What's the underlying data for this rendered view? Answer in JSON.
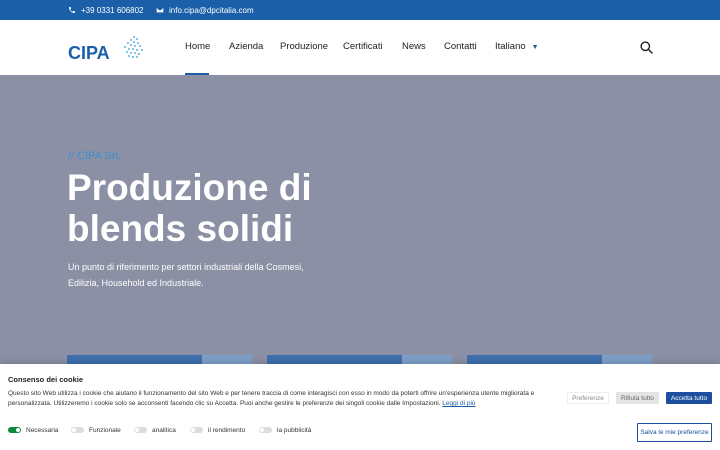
{
  "topbar": {
    "phone": "+39 0331 606802",
    "email": "info.cipa@dpcitalia.com",
    "phone_icon": "phone-icon",
    "email_icon": "envelope-icon"
  },
  "header": {
    "logo_text": "CIPA",
    "nav": [
      {
        "label": "Home",
        "active": true
      },
      {
        "label": "Azienda"
      },
      {
        "label": "Produzione"
      },
      {
        "label": "Certificati"
      },
      {
        "label": "News"
      },
      {
        "label": "Contatti"
      },
      {
        "label": "Italiano",
        "has_dropdown": true
      }
    ],
    "search_icon": "search-icon",
    "accent_color": "#1b5fa8"
  },
  "hero": {
    "eyebrow": "// CIPA Srl.",
    "title_line1": "Produzione di",
    "title_line2": "blends solidi",
    "subtitle_line1": "Un punto di riferimento per settori industriali della Cosmesi,",
    "subtitle_line2": "Edilizia, Household ed Industriale.",
    "background_color": "#8b90a5"
  },
  "cookie": {
    "title": "Consenso dei cookie",
    "text_line1": "Questo sito Web utilizza i cookie che aiutano il funzionamento del sito Web e per tenere traccia di come interagisci con esso in modo da poterti offrire un'esperienza utente migliorata e",
    "text_line2": "personalizzata. Utilizzeremo i cookie solo se acconsenti facendo clic su Accetta. Puoi anche gestire le preferenze dei singoli cookie dalle Impostazioni.",
    "read_more": "Leggi di più",
    "buttons": {
      "preferences": "Preferenze",
      "reject": "Rifiuta tutto",
      "accept": "Accetta tutto",
      "save": "Salva le mie preferenze"
    },
    "toggles": [
      {
        "label": "Necessaria",
        "on": true
      },
      {
        "label": "Funzionale",
        "on": false
      },
      {
        "label": "analitica",
        "on": false
      },
      {
        "label": "il rendimento",
        "on": false
      },
      {
        "label": "la pubblicità",
        "on": false
      }
    ]
  }
}
